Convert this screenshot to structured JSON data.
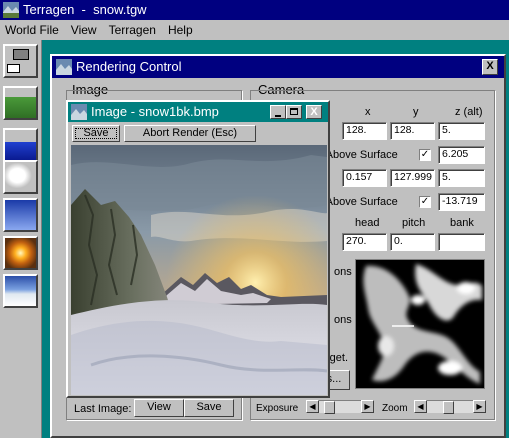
{
  "app": {
    "title": "Terragen  -  snow.tgw"
  },
  "menu": [
    "World File",
    "View",
    "Terragen",
    "Help"
  ],
  "rendering_control": {
    "title": "Rendering Control",
    "close_glyph": "X",
    "image_group": "Image",
    "camera_group": "Camera",
    "col_x": "x",
    "col_y": "y",
    "col_z": "z (alt)",
    "camera_x": "128.",
    "camera_y": "128.",
    "camera_z": "5.",
    "height_label_1": "ht Above Surface",
    "height_value_1": "6.205",
    "target_x": "0.157",
    "target_y": "127.999",
    "target_z": "5.",
    "height_label_2": "ht Above Surface",
    "height_value_2": "-13.719",
    "col_head": "head",
    "col_pitch": "pitch",
    "col_bank": "bank",
    "head": "270.",
    "pitch": "0.",
    "bank": "",
    "partial_1": "ons",
    "partial_2": "ons",
    "partial_3": "rget.",
    "partial_button": "s...",
    "last_image_label": "Last Image:",
    "view_label": "View",
    "save_label": "Save",
    "exposure_label": "Exposure",
    "zoom_label": "Zoom",
    "exposure_level": 0.15,
    "zoom_level": 0.45
  },
  "image_window": {
    "title": "Image - snow1bk.bmp",
    "save_label": "Save",
    "abort_label": "Abort Render (Esc)",
    "close_glyph": "X"
  },
  "colors": {
    "desktop": "#008080",
    "title_active": "#000080",
    "face": "#c0c0c0"
  }
}
